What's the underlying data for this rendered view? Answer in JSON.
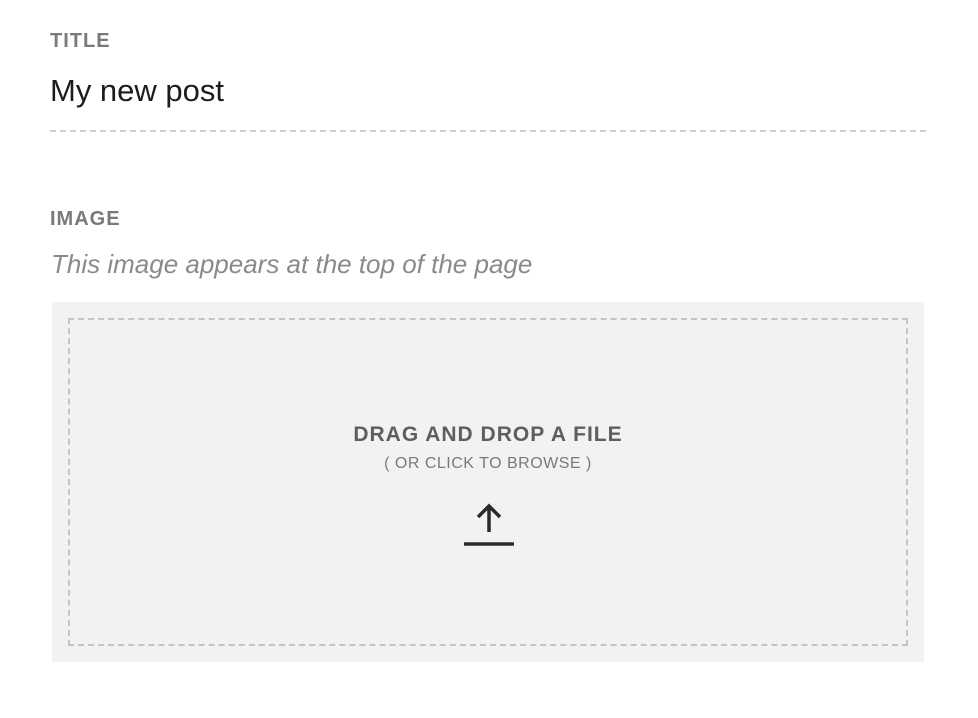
{
  "title_field": {
    "label": "TITLE",
    "value": "My new post"
  },
  "image_field": {
    "label": "IMAGE",
    "hint": "This image appears at the top of the page",
    "dropzone": {
      "title": "DRAG AND DROP A FILE",
      "subtitle": "( OR CLICK TO BROWSE )",
      "icon": "upload-icon"
    }
  },
  "colors": {
    "label": "#7a7a7a",
    "text": "#1c1c1c",
    "hint": "#8a8a8a",
    "dropzone_bg": "#f2f2f2",
    "dropzone_border": "#c4c4c4",
    "icon": "#2b2b2b"
  }
}
